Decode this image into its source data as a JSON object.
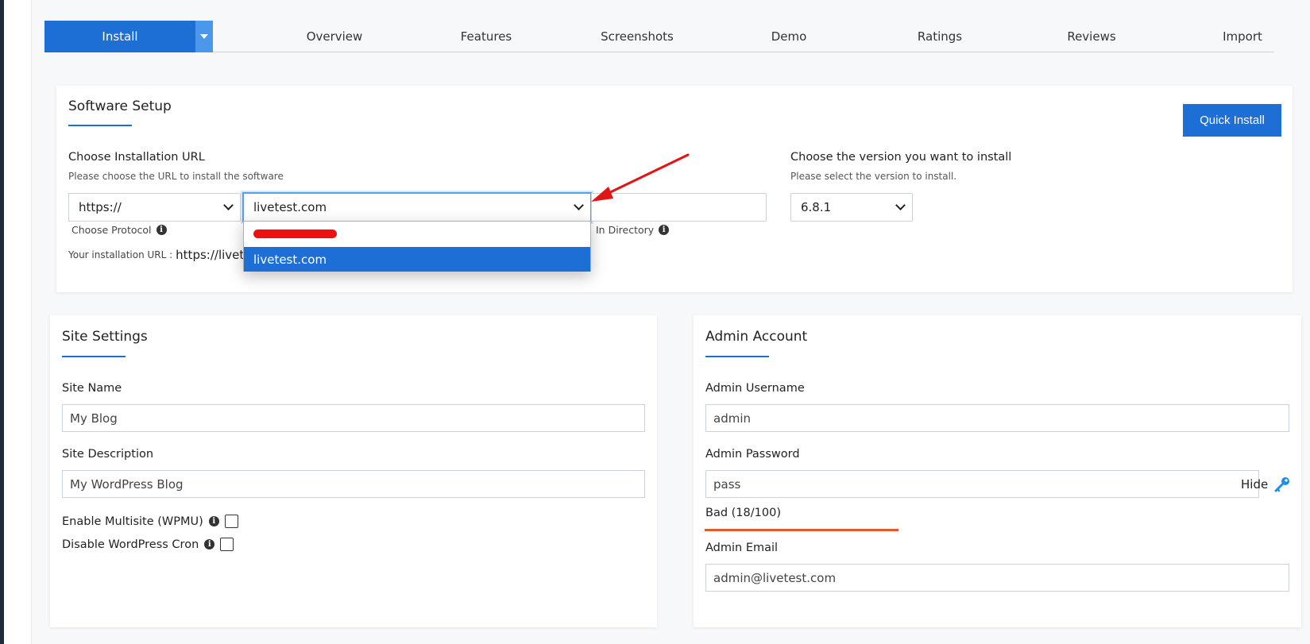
{
  "tabs": {
    "install": "Install",
    "items": [
      "Overview",
      "Features",
      "Screenshots",
      "Demo",
      "Ratings",
      "Reviews",
      "Import"
    ]
  },
  "software_setup": {
    "title": "Software Setup",
    "quick_install": "Quick Install",
    "url_label": "Choose Installation URL",
    "url_sublabel": "Please choose the URL to install the software",
    "protocol_value": "https://",
    "protocol_label": "Choose Protocol",
    "domain_value": "livetest.com",
    "directory_label": "In Directory",
    "domain_options": [
      "livetest.com"
    ],
    "install_url_label": "Your installation URL :",
    "install_url_value": "https://livetes",
    "version_label": "Choose the version you want to install",
    "version_sublabel": "Please select the version to install.",
    "version_value": "6.8.1"
  },
  "site_settings": {
    "title": "Site Settings",
    "site_name_label": "Site Name",
    "site_name_value": "My Blog",
    "site_desc_label": "Site Description",
    "site_desc_value": "My WordPress Blog",
    "multisite_label": "Enable Multisite (WPMU)",
    "cron_label": "Disable WordPress Cron"
  },
  "admin_account": {
    "title": "Admin Account",
    "username_label": "Admin Username",
    "username_value": "admin",
    "password_label": "Admin Password",
    "password_value": "pass",
    "hide_label": "Hide",
    "strength_text": "Bad (18/100)",
    "strength_percent": 18,
    "email_label": "Admin Email",
    "email_value": "admin@livetest.com"
  },
  "colors": {
    "accent": "#1d6fd6",
    "strength_bad": "#e05a2a",
    "annotation_arrow": "#e01515"
  }
}
